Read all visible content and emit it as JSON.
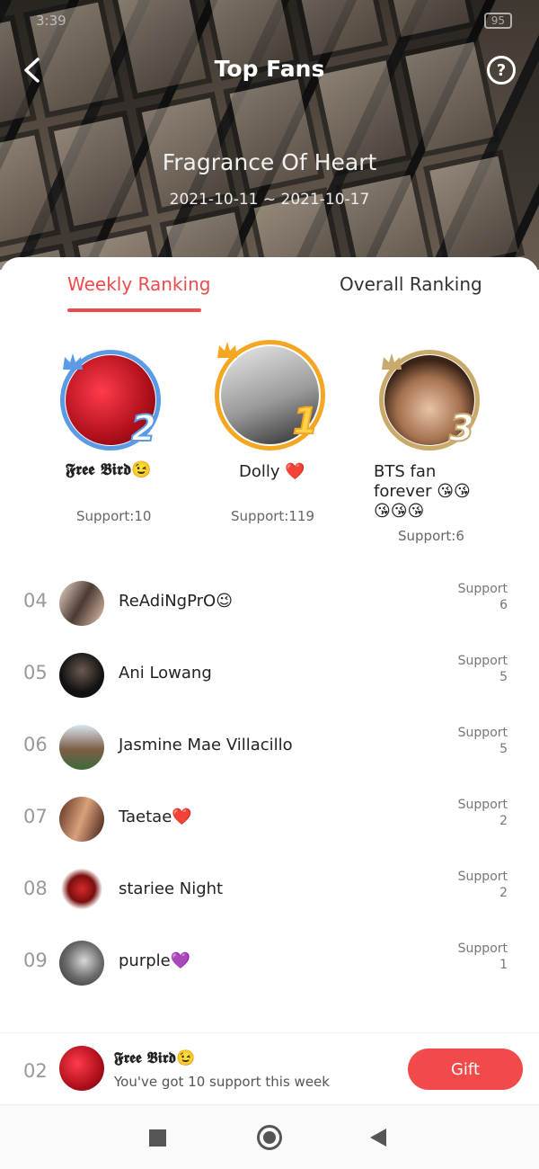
{
  "status_bar": {
    "time": "3:39",
    "battery": "95"
  },
  "header": {
    "title": "Top Fans",
    "book_title": "Fragrance Of Heart",
    "date_range": "2021-10-11 ~ 2021-10-17"
  },
  "tabs": {
    "weekly": "Weekly Ranking",
    "overall": "Overall Ranking"
  },
  "podium": [
    {
      "rank": "2",
      "name": "𝕱𝖗𝖊𝖊 𝕭𝖎𝖗𝖉😉",
      "support": "Support:10",
      "ring_color": "#5b9be6"
    },
    {
      "rank": "1",
      "name": "Dolly ❤️",
      "support": "Support:119",
      "ring_color": "#f5a623"
    },
    {
      "rank": "3",
      "name": "BTS fan forever 😘😘😘😘😘",
      "support": "Support:6",
      "ring_color": "#c9aa6b"
    }
  ],
  "list": [
    {
      "rank": "04",
      "name": "ReAdiNgPrO😉",
      "support_label": "Support",
      "support_value": "6"
    },
    {
      "rank": "05",
      "name": "Ani Lowang",
      "support_label": "Support",
      "support_value": "5"
    },
    {
      "rank": "06",
      "name": "Jasmine Mae Villacillo",
      "support_label": "Support",
      "support_value": "5"
    },
    {
      "rank": "07",
      "name": "Taetae❤️",
      "support_label": "Support",
      "support_value": "2"
    },
    {
      "rank": "08",
      "name": "stariee Night",
      "support_label": "Support",
      "support_value": "2"
    },
    {
      "rank": "09",
      "name": "purple💜",
      "support_label": "Support",
      "support_value": "1"
    }
  ],
  "my_rank": {
    "rank": "02",
    "name": "𝕱𝖗𝖊𝖊 𝕭𝖎𝖗𝖉😉",
    "subtitle": "You've got 10 support this week",
    "button": "Gift"
  },
  "colors": {
    "accent": "#ef4b4b",
    "gold": "#f5a623",
    "silver": "#5b9be6",
    "bronze": "#c9aa6b"
  }
}
